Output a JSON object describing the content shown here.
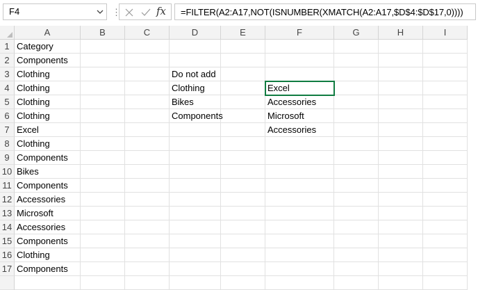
{
  "formula_bar": {
    "name_box": "F4",
    "formula": "=FILTER(A2:A17,NOT(ISNUMBER(XMATCH(A2:A17,$D$4:$D$17,0))))",
    "separator": "⋮",
    "fx_label": "fx"
  },
  "columns": [
    "A",
    "B",
    "C",
    "D",
    "E",
    "F",
    "G",
    "H",
    "I"
  ],
  "rows": [
    "1",
    "2",
    "3",
    "4",
    "5",
    "6",
    "7",
    "8",
    "9",
    "10",
    "11",
    "12",
    "13",
    "14",
    "15",
    "16",
    "17"
  ],
  "cells": {
    "A1": "Category",
    "A2": "Components",
    "A3": "Clothing",
    "A4": "Clothing",
    "A5": "Clothing",
    "A6": "Clothing",
    "A7": "Excel",
    "A8": "Clothing",
    "A9": "Components",
    "A10": "Bikes",
    "A11": "Components",
    "A12": "Accessories",
    "A13": "Microsoft",
    "A14": "Accessories",
    "A15": "Components",
    "A16": "Clothing",
    "A17": "Components",
    "D3": "Do not add",
    "D4": "Clothing",
    "D5": "Bikes",
    "D6": "Components",
    "F4": "Excel",
    "F5": "Accessories",
    "F6": "Microsoft",
    "F7": "Accessories"
  },
  "selected_cell": "F4",
  "colors": {
    "selection": "#107c41",
    "header_bg": "#f3f3f3",
    "gridline": "#e1e1e1"
  }
}
